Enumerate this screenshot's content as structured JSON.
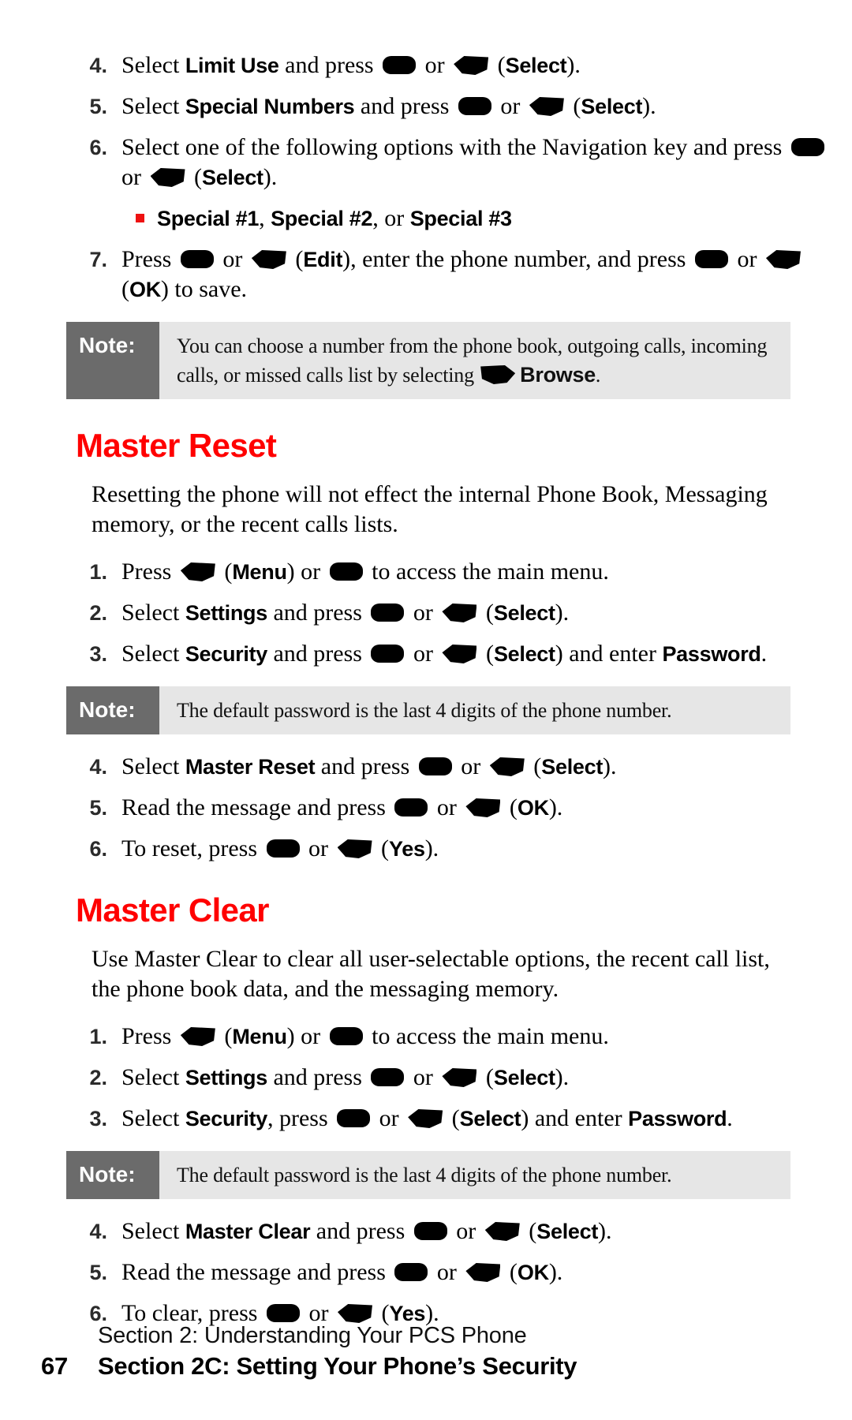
{
  "document": {
    "page_number": "67",
    "footer_section": "Section 2: Understanding Your PCS Phone",
    "footer_subsection": "Section 2C: Setting Your Phone’s Security"
  },
  "colors": {
    "heading_red": "#ff0000",
    "bullet_red": "#ee1111",
    "note_label_bg": "#6b6b6b",
    "note_body_bg": "#e6e6e6",
    "text": "#000000"
  },
  "icons": {
    "ok_key": "ok-key-icon",
    "softkey_left": "left-softkey-icon",
    "softkey_right": "right-softkey-icon",
    "bullet": "red-square-bullet-icon"
  },
  "special_numbers_steps": [
    {
      "number": "4.",
      "parts": [
        {
          "t": "text",
          "v": "Select "
        },
        {
          "t": "bold",
          "v": "Limit Use"
        },
        {
          "t": "text",
          "v": " and press "
        },
        {
          "t": "key_ok"
        },
        {
          "t": "text",
          "v": " or "
        },
        {
          "t": "key_soft_left"
        },
        {
          "t": "text",
          "v": " ("
        },
        {
          "t": "bold",
          "v": "Select"
        },
        {
          "t": "text",
          "v": ")."
        }
      ]
    },
    {
      "number": "5.",
      "parts": [
        {
          "t": "text",
          "v": "Select "
        },
        {
          "t": "bold",
          "v": "Special Numbers"
        },
        {
          "t": "text",
          "v": " and press "
        },
        {
          "t": "key_ok"
        },
        {
          "t": "text",
          "v": " or "
        },
        {
          "t": "key_soft_left"
        },
        {
          "t": "text",
          "v": " ("
        },
        {
          "t": "bold",
          "v": "Select"
        },
        {
          "t": "text",
          "v": ")."
        }
      ]
    },
    {
      "number": "6.",
      "parts": [
        {
          "t": "text",
          "v": "Select one of the following options with the Navigation key and press "
        },
        {
          "t": "key_ok"
        },
        {
          "t": "text",
          "v": " or "
        },
        {
          "t": "key_soft_left"
        },
        {
          "t": "text",
          "v": " ("
        },
        {
          "t": "bold",
          "v": "Select"
        },
        {
          "t": "text",
          "v": ")."
        }
      ]
    }
  ],
  "special_options_bullet": {
    "parts": [
      {
        "t": "bold",
        "v": "Special #1"
      },
      {
        "t": "text",
        "v": ", "
      },
      {
        "t": "bold",
        "v": "Special #2"
      },
      {
        "t": "text",
        "v": ", or "
      },
      {
        "t": "bold",
        "v": "Special #3"
      }
    ]
  },
  "special_numbers_step7": {
    "number": "7.",
    "parts": [
      {
        "t": "text",
        "v": "Press "
      },
      {
        "t": "key_ok"
      },
      {
        "t": "text",
        "v": " or "
      },
      {
        "t": "key_soft_left"
      },
      {
        "t": "text",
        "v": " ("
      },
      {
        "t": "bold",
        "v": "Edit"
      },
      {
        "t": "text",
        "v": "), enter the phone number, and press "
      },
      {
        "t": "key_ok"
      },
      {
        "t": "text",
        "v": " or "
      },
      {
        "t": "key_soft_left"
      },
      {
        "t": "text",
        "v": " ("
      },
      {
        "t": "bold",
        "v": "OK"
      },
      {
        "t": "text",
        "v": ") to save."
      }
    ]
  },
  "note_browse": {
    "label": "Note:",
    "parts": [
      {
        "t": "text",
        "v": "You can choose a number from the phone book, outgoing calls, incoming calls, or missed calls list by selecting "
      },
      {
        "t": "key_soft_right"
      },
      {
        "t": "bold",
        "v": "Browse"
      },
      {
        "t": "text",
        "v": "."
      }
    ]
  },
  "master_reset": {
    "heading": "Master Reset",
    "intro": "Resetting the phone will not effect the internal Phone Book, Messaging memory, or the recent calls lists.",
    "steps_before_note": [
      {
        "number": "1.",
        "parts": [
          {
            "t": "text",
            "v": "Press "
          },
          {
            "t": "key_soft_left"
          },
          {
            "t": "text",
            "v": " ("
          },
          {
            "t": "bold",
            "v": "Menu"
          },
          {
            "t": "text",
            "v": ") or "
          },
          {
            "t": "key_ok"
          },
          {
            "t": "text",
            "v": " to access the main menu."
          }
        ]
      },
      {
        "number": "2.",
        "parts": [
          {
            "t": "text",
            "v": "Select "
          },
          {
            "t": "bold",
            "v": "Settings"
          },
          {
            "t": "text",
            "v": " and press "
          },
          {
            "t": "key_ok"
          },
          {
            "t": "text",
            "v": " or "
          },
          {
            "t": "key_soft_left"
          },
          {
            "t": "text",
            "v": " ("
          },
          {
            "t": "bold",
            "v": "Select"
          },
          {
            "t": "text",
            "v": ")."
          }
        ]
      },
      {
        "number": "3.",
        "parts": [
          {
            "t": "text",
            "v": "Select "
          },
          {
            "t": "bold",
            "v": "Security"
          },
          {
            "t": "text",
            "v": " and press "
          },
          {
            "t": "key_ok"
          },
          {
            "t": "text",
            "v": " or "
          },
          {
            "t": "key_soft_left"
          },
          {
            "t": "text",
            "v": " ("
          },
          {
            "t": "bold",
            "v": "Select"
          },
          {
            "t": "text",
            "v": ") and enter "
          },
          {
            "t": "bold",
            "v": "Password"
          },
          {
            "t": "text",
            "v": "."
          }
        ]
      }
    ],
    "note": {
      "label": "Note:",
      "parts": [
        {
          "t": "text",
          "v": "The default password is the last 4 digits of the phone number."
        }
      ]
    },
    "steps_after_note": [
      {
        "number": "4.",
        "parts": [
          {
            "t": "text",
            "v": "Select "
          },
          {
            "t": "bold",
            "v": "Master Reset"
          },
          {
            "t": "text",
            "v": " and press "
          },
          {
            "t": "key_ok"
          },
          {
            "t": "text",
            "v": " or "
          },
          {
            "t": "key_soft_left"
          },
          {
            "t": "text",
            "v": " ("
          },
          {
            "t": "bold",
            "v": "Select"
          },
          {
            "t": "text",
            "v": ")."
          }
        ]
      },
      {
        "number": "5.",
        "parts": [
          {
            "t": "text",
            "v": "Read the message and press "
          },
          {
            "t": "key_ok"
          },
          {
            "t": "text",
            "v": " or "
          },
          {
            "t": "key_soft_left"
          },
          {
            "t": "text",
            "v": " ("
          },
          {
            "t": "bold",
            "v": "OK"
          },
          {
            "t": "text",
            "v": ")."
          }
        ]
      },
      {
        "number": "6.",
        "parts": [
          {
            "t": "text",
            "v": "To reset, press "
          },
          {
            "t": "key_ok"
          },
          {
            "t": "text",
            "v": " or "
          },
          {
            "t": "key_soft_left"
          },
          {
            "t": "text",
            "v": " ("
          },
          {
            "t": "bold",
            "v": "Yes"
          },
          {
            "t": "text",
            "v": ")."
          }
        ]
      }
    ]
  },
  "master_clear": {
    "heading": "Master Clear",
    "intro": "Use Master Clear to clear all user-selectable options, the recent call list, the phone book data, and the messaging memory.",
    "steps_before_note": [
      {
        "number": "1.",
        "parts": [
          {
            "t": "text",
            "v": "Press "
          },
          {
            "t": "key_soft_left"
          },
          {
            "t": "text",
            "v": " ("
          },
          {
            "t": "bold",
            "v": "Menu"
          },
          {
            "t": "text",
            "v": ") or "
          },
          {
            "t": "key_ok"
          },
          {
            "t": "text",
            "v": " to access the main menu."
          }
        ]
      },
      {
        "number": "2.",
        "parts": [
          {
            "t": "text",
            "v": "Select "
          },
          {
            "t": "bold",
            "v": "Settings"
          },
          {
            "t": "text",
            "v": " and press "
          },
          {
            "t": "key_ok"
          },
          {
            "t": "text",
            "v": " or "
          },
          {
            "t": "key_soft_left"
          },
          {
            "t": "text",
            "v": " ("
          },
          {
            "t": "bold",
            "v": "Select"
          },
          {
            "t": "text",
            "v": ")."
          }
        ]
      },
      {
        "number": "3.",
        "parts": [
          {
            "t": "text",
            "v": "Select "
          },
          {
            "t": "bold",
            "v": "Security"
          },
          {
            "t": "text",
            "v": ", press "
          },
          {
            "t": "key_ok"
          },
          {
            "t": "text",
            "v": " or "
          },
          {
            "t": "key_soft_left"
          },
          {
            "t": "text",
            "v": " ("
          },
          {
            "t": "bold",
            "v": "Select"
          },
          {
            "t": "text",
            "v": ") and enter "
          },
          {
            "t": "bold",
            "v": "Password"
          },
          {
            "t": "text",
            "v": "."
          }
        ]
      }
    ],
    "note": {
      "label": "Note:",
      "parts": [
        {
          "t": "text",
          "v": "The default password is the last 4 digits of the phone number."
        }
      ]
    },
    "steps_after_note": [
      {
        "number": "4.",
        "parts": [
          {
            "t": "text",
            "v": "Select "
          },
          {
            "t": "bold",
            "v": "Master Clear"
          },
          {
            "t": "text",
            "v": " and press "
          },
          {
            "t": "key_ok"
          },
          {
            "t": "text",
            "v": " or "
          },
          {
            "t": "key_soft_left"
          },
          {
            "t": "text",
            "v": " ("
          },
          {
            "t": "bold",
            "v": "Select"
          },
          {
            "t": "text",
            "v": ")."
          }
        ]
      },
      {
        "number": "5.",
        "parts": [
          {
            "t": "text",
            "v": "Read the message and press "
          },
          {
            "t": "key_ok"
          },
          {
            "t": "text",
            "v": " or "
          },
          {
            "t": "key_soft_left"
          },
          {
            "t": "text",
            "v": " ("
          },
          {
            "t": "bold",
            "v": "OK"
          },
          {
            "t": "text",
            "v": ")."
          }
        ]
      },
      {
        "number": "6.",
        "parts": [
          {
            "t": "text",
            "v": "To clear, press "
          },
          {
            "t": "key_ok"
          },
          {
            "t": "text",
            "v": " or "
          },
          {
            "t": "key_soft_left"
          },
          {
            "t": "text",
            "v": " ("
          },
          {
            "t": "bold",
            "v": "Yes"
          },
          {
            "t": "text",
            "v": ")."
          }
        ]
      }
    ]
  }
}
